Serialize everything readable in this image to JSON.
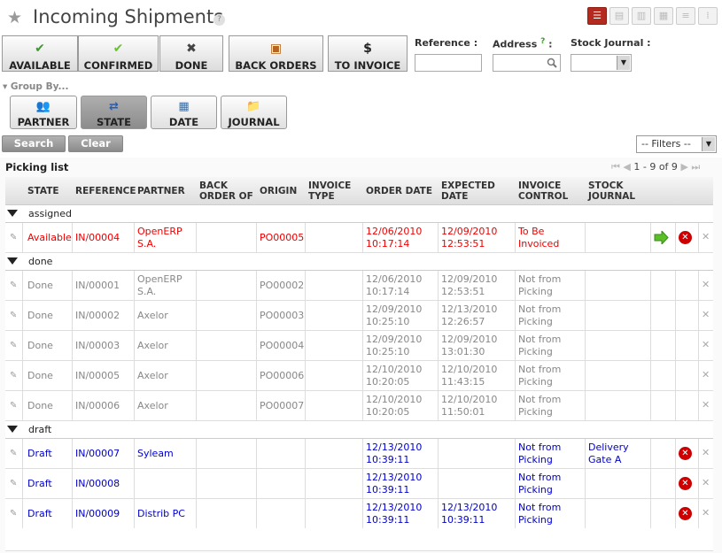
{
  "header": {
    "title": "Incoming Shipments",
    "help": "?",
    "view_buttons": [
      "list-view-icon",
      "form-view-icon",
      "graph-view-icon",
      "calendar-view-icon",
      "gantt-view-icon",
      "kanban-view-icon"
    ]
  },
  "filter_buttons": [
    {
      "name": "available",
      "icon": "✔",
      "label": "AVAILABLE",
      "icon_color": "#3a9a2a"
    },
    {
      "name": "confirmed",
      "icon": "✔",
      "label": "CONFIRMED",
      "icon_color": "#6cbf3a"
    },
    {
      "name": "done",
      "icon": "✖",
      "label": "DONE",
      "icon_color": "#444444"
    },
    {
      "name": "back-orders",
      "icon": "▣",
      "label": "BACK ORDERS",
      "icon_color": "#b5651d"
    },
    {
      "name": "to-invoice",
      "icon": "$",
      "label": "TO INVOICE",
      "icon_color": "#222222"
    }
  ],
  "fields": {
    "reference_label": "Reference :",
    "address_label": "Address",
    "address_help": "?",
    "address_colon": ":",
    "stock_journal_label": "Stock Journal :"
  },
  "group_by": {
    "label": "▾ Group By...",
    "buttons": [
      {
        "name": "partner",
        "icon": "👥",
        "label": "PARTNER",
        "active": false
      },
      {
        "name": "state",
        "icon": "⇄",
        "label": "STATE",
        "active": true
      },
      {
        "name": "date",
        "icon": "▦",
        "label": "DATE",
        "active": false
      },
      {
        "name": "journal",
        "icon": "📁",
        "label": "JOURNAL",
        "active": false
      }
    ]
  },
  "actions": {
    "search": "Search",
    "clear": "Clear",
    "filters": "-- Filters --"
  },
  "list": {
    "title": "Picking list",
    "pager": "1 - 9 of 9",
    "columns": [
      "STATE",
      "REFERENCE",
      "PARTNER",
      "BACK ORDER OF",
      "ORIGIN",
      "INVOICE TYPE",
      "ORDER DATE",
      "EXPECTED DATE",
      "INVOICE CONTROL",
      "STOCK JOURNAL"
    ],
    "groups": [
      {
        "label": "assigned",
        "color": "red",
        "rows": [
          {
            "state": "Available",
            "reference": "IN/00004",
            "partner": "OpenERP S.A.",
            "back_order": "",
            "origin": "PO00005",
            "invoice_type": "",
            "order_date": "12/06/2010 10:17:14",
            "expected_date": "12/09/2010 12:53:51",
            "invoice_control": "To Be Invoiced",
            "journal": "",
            "go": true,
            "cancel": true
          }
        ]
      },
      {
        "label": "done",
        "color": "gray",
        "rows": [
          {
            "state": "Done",
            "reference": "IN/00001",
            "partner": "OpenERP S.A.",
            "back_order": "",
            "origin": "PO00002",
            "invoice_type": "",
            "order_date": "12/06/2010 10:17:14",
            "expected_date": "12/09/2010 12:53:51",
            "invoice_control": "Not from Picking",
            "journal": "",
            "go": false,
            "cancel": false
          },
          {
            "state": "Done",
            "reference": "IN/00002",
            "partner": "Axelor",
            "back_order": "",
            "origin": "PO00003",
            "invoice_type": "",
            "order_date": "12/09/2010 10:25:10",
            "expected_date": "12/13/2010 12:26:57",
            "invoice_control": "Not from Picking",
            "journal": "",
            "go": false,
            "cancel": false
          },
          {
            "state": "Done",
            "reference": "IN/00003",
            "partner": "Axelor",
            "back_order": "",
            "origin": "PO00004",
            "invoice_type": "",
            "order_date": "12/09/2010 10:25:10",
            "expected_date": "12/09/2010 13:01:30",
            "invoice_control": "Not from Picking",
            "journal": "",
            "go": false,
            "cancel": false
          },
          {
            "state": "Done",
            "reference": "IN/00005",
            "partner": "Axelor",
            "back_order": "",
            "origin": "PO00006",
            "invoice_type": "",
            "order_date": "12/10/2010 10:20:05",
            "expected_date": "12/10/2010 11:43:15",
            "invoice_control": "Not from Picking",
            "journal": "",
            "go": false,
            "cancel": false
          },
          {
            "state": "Done",
            "reference": "IN/00006",
            "partner": "Axelor",
            "back_order": "",
            "origin": "PO00007",
            "invoice_type": "",
            "order_date": "12/10/2010 10:20:05",
            "expected_date": "12/10/2010 11:50:01",
            "invoice_control": "Not from Picking",
            "journal": "",
            "go": false,
            "cancel": false
          }
        ]
      },
      {
        "label": "draft",
        "color": "blue",
        "rows": [
          {
            "state": "Draft",
            "reference": "IN/00007",
            "partner": "Syleam",
            "back_order": "",
            "origin": "",
            "invoice_type": "",
            "order_date": "12/13/2010 10:39:11",
            "expected_date": "",
            "invoice_control": "Not from Picking",
            "journal": "Delivery Gate A",
            "go": false,
            "cancel": true
          },
          {
            "state": "Draft",
            "reference": "IN/00008",
            "partner": "",
            "back_order": "",
            "origin": "",
            "invoice_type": "",
            "order_date": "12/13/2010 10:39:11",
            "expected_date": "",
            "invoice_control": "Not from Picking",
            "journal": "",
            "go": false,
            "cancel": true
          },
          {
            "state": "Draft",
            "reference": "IN/00009",
            "partner": "Distrib PC",
            "back_order": "",
            "origin": "",
            "invoice_type": "",
            "order_date": "12/13/2010 10:39:11",
            "expected_date": "12/13/2010 10:39:11",
            "invoice_control": "Not from Picking",
            "journal": "",
            "go": false,
            "cancel": true
          }
        ]
      }
    ]
  }
}
